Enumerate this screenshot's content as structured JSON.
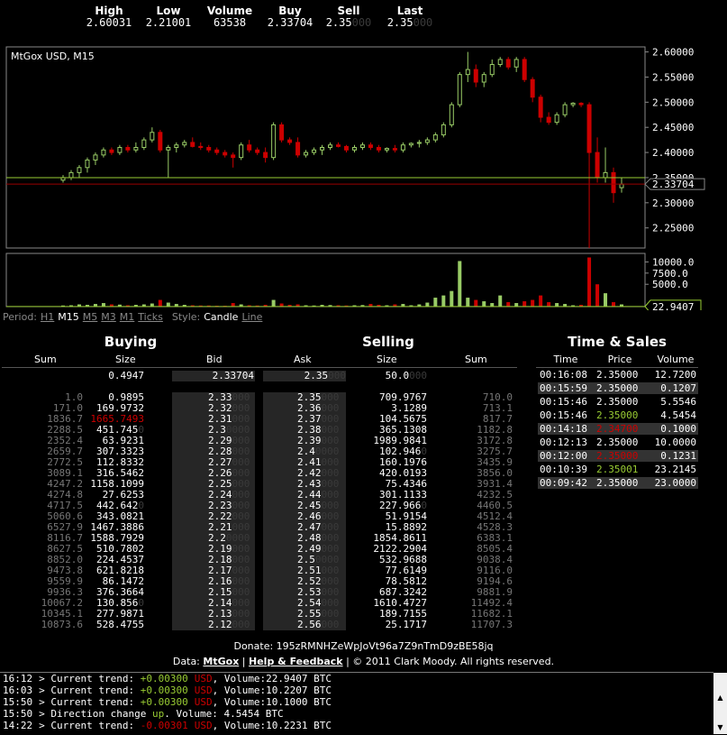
{
  "ticker": [
    {
      "label": "High",
      "value": "2.60031",
      "faint": ""
    },
    {
      "label": "Low",
      "value": "2.21001",
      "faint": ""
    },
    {
      "label": "Volume",
      "value": "63538",
      "faint": ""
    },
    {
      "label": "Buy",
      "value": "2.33704",
      "faint": ""
    },
    {
      "label": "Sell",
      "value": "2.35",
      "faint": "000"
    },
    {
      "label": "Last",
      "value": "2.35",
      "faint": "000"
    }
  ],
  "chart": {
    "title": "MtGox USD, M15",
    "price_ticks": [
      "2.60000",
      "2.55000",
      "2.50000",
      "2.45000",
      "2.40000",
      "2.35000",
      "2.30000",
      "2.25000"
    ],
    "current_price": "2.33704",
    "volume_ticks": [
      "10000.0",
      "7500.0",
      "5000.0"
    ],
    "volume_last": "22.9407",
    "colors": {
      "up": "#9c6",
      "down": "#c00",
      "bg": "#000",
      "border": "#888",
      "line_green": "#9c3",
      "line_red": "#900"
    }
  },
  "chart_data": {
    "type": "candlestick",
    "title": "MtGox USD, M15",
    "y_range": [
      2.21,
      2.61
    ],
    "volume_range": [
      0,
      11500
    ],
    "candles": [
      {
        "o": 2.345,
        "h": 2.355,
        "l": 2.34,
        "c": 2.35,
        "v": 250
      },
      {
        "o": 2.35,
        "h": 2.365,
        "l": 2.345,
        "c": 2.36,
        "v": 300
      },
      {
        "o": 2.36,
        "h": 2.375,
        "l": 2.35,
        "c": 2.37,
        "v": 500
      },
      {
        "o": 2.37,
        "h": 2.39,
        "l": 2.36,
        "c": 2.385,
        "v": 400
      },
      {
        "o": 2.385,
        "h": 2.4,
        "l": 2.375,
        "c": 2.395,
        "v": 600
      },
      {
        "o": 2.395,
        "h": 2.41,
        "l": 2.39,
        "c": 2.405,
        "v": 800
      },
      {
        "o": 2.405,
        "h": 2.41,
        "l": 2.395,
        "c": 2.4,
        "v": 500
      },
      {
        "o": 2.4,
        "h": 2.415,
        "l": 2.395,
        "c": 2.41,
        "v": 450
      },
      {
        "o": 2.41,
        "h": 2.415,
        "l": 2.4,
        "c": 2.405,
        "v": 300
      },
      {
        "o": 2.405,
        "h": 2.42,
        "l": 2.4,
        "c": 2.41,
        "v": 400
      },
      {
        "o": 2.41,
        "h": 2.43,
        "l": 2.405,
        "c": 2.425,
        "v": 500
      },
      {
        "o": 2.425,
        "h": 2.45,
        "l": 2.42,
        "c": 2.44,
        "v": 700
      },
      {
        "o": 2.44,
        "h": 2.445,
        "l": 2.4,
        "c": 2.405,
        "v": 1500
      },
      {
        "o": 2.405,
        "h": 2.415,
        "l": 2.35,
        "c": 2.41,
        "v": 900
      },
      {
        "o": 2.41,
        "h": 2.42,
        "l": 2.4,
        "c": 2.415,
        "v": 600
      },
      {
        "o": 2.415,
        "h": 2.425,
        "l": 2.41,
        "c": 2.42,
        "v": 400
      },
      {
        "o": 2.42,
        "h": 2.43,
        "l": 2.41,
        "c": 2.412,
        "v": 300
      },
      {
        "o": 2.412,
        "h": 2.42,
        "l": 2.405,
        "c": 2.41,
        "v": 250
      },
      {
        "o": 2.41,
        "h": 2.415,
        "l": 2.4,
        "c": 2.405,
        "v": 250
      },
      {
        "o": 2.405,
        "h": 2.41,
        "l": 2.395,
        "c": 2.4,
        "v": 200
      },
      {
        "o": 2.4,
        "h": 2.405,
        "l": 2.39,
        "c": 2.395,
        "v": 200
      },
      {
        "o": 2.395,
        "h": 2.4,
        "l": 2.37,
        "c": 2.39,
        "v": 800
      },
      {
        "o": 2.39,
        "h": 2.42,
        "l": 2.385,
        "c": 2.415,
        "v": 500
      },
      {
        "o": 2.415,
        "h": 2.425,
        "l": 2.4,
        "c": 2.405,
        "v": 300
      },
      {
        "o": 2.405,
        "h": 2.41,
        "l": 2.395,
        "c": 2.4,
        "v": 250
      },
      {
        "o": 2.4,
        "h": 2.41,
        "l": 2.38,
        "c": 2.39,
        "v": 400
      },
      {
        "o": 2.39,
        "h": 2.46,
        "l": 2.385,
        "c": 2.455,
        "v": 1500
      },
      {
        "o": 2.455,
        "h": 2.46,
        "l": 2.42,
        "c": 2.425,
        "v": 700
      },
      {
        "o": 2.425,
        "h": 2.43,
        "l": 2.415,
        "c": 2.42,
        "v": 400
      },
      {
        "o": 2.42,
        "h": 2.43,
        "l": 2.39,
        "c": 2.395,
        "v": 500
      },
      {
        "o": 2.395,
        "h": 2.405,
        "l": 2.39,
        "c": 2.4,
        "v": 300
      },
      {
        "o": 2.4,
        "h": 2.41,
        "l": 2.395,
        "c": 2.405,
        "v": 250
      },
      {
        "o": 2.405,
        "h": 2.415,
        "l": 2.395,
        "c": 2.41,
        "v": 400
      },
      {
        "o": 2.41,
        "h": 2.42,
        "l": 2.405,
        "c": 2.415,
        "v": 350
      },
      {
        "o": 2.415,
        "h": 2.42,
        "l": 2.41,
        "c": 2.412,
        "v": 300
      },
      {
        "o": 2.412,
        "h": 2.415,
        "l": 2.4,
        "c": 2.405,
        "v": 250
      },
      {
        "o": 2.405,
        "h": 2.415,
        "l": 2.4,
        "c": 2.41,
        "v": 300
      },
      {
        "o": 2.41,
        "h": 2.42,
        "l": 2.405,
        "c": 2.415,
        "v": 350
      },
      {
        "o": 2.415,
        "h": 2.42,
        "l": 2.405,
        "c": 2.41,
        "v": 600
      },
      {
        "o": 2.41,
        "h": 2.415,
        "l": 2.4,
        "c": 2.405,
        "v": 400
      },
      {
        "o": 2.405,
        "h": 2.41,
        "l": 2.4,
        "c": 2.408,
        "v": 300
      },
      {
        "o": 2.408,
        "h": 2.415,
        "l": 2.4,
        "c": 2.405,
        "v": 500
      },
      {
        "o": 2.405,
        "h": 2.42,
        "l": 2.4,
        "c": 2.415,
        "v": 600
      },
      {
        "o": 2.415,
        "h": 2.42,
        "l": 2.41,
        "c": 2.418,
        "v": 300
      },
      {
        "o": 2.418,
        "h": 2.425,
        "l": 2.41,
        "c": 2.42,
        "v": 500
      },
      {
        "o": 2.42,
        "h": 2.43,
        "l": 2.415,
        "c": 2.425,
        "v": 900
      },
      {
        "o": 2.425,
        "h": 2.44,
        "l": 2.42,
        "c": 2.435,
        "v": 2000
      },
      {
        "o": 2.435,
        "h": 2.46,
        "l": 2.43,
        "c": 2.455,
        "v": 2500
      },
      {
        "o": 2.455,
        "h": 2.5,
        "l": 2.45,
        "c": 2.495,
        "v": 3500
      },
      {
        "o": 2.495,
        "h": 2.56,
        "l": 2.49,
        "c": 2.555,
        "v": 10200
      },
      {
        "o": 2.555,
        "h": 2.6,
        "l": 2.54,
        "c": 2.565,
        "v": 2000
      },
      {
        "o": 2.565,
        "h": 2.575,
        "l": 2.53,
        "c": 2.54,
        "v": 1500
      },
      {
        "o": 2.54,
        "h": 2.56,
        "l": 2.53,
        "c": 2.555,
        "v": 1200
      },
      {
        "o": 2.555,
        "h": 2.585,
        "l": 2.55,
        "c": 2.575,
        "v": 800
      },
      {
        "o": 2.575,
        "h": 2.59,
        "l": 2.57,
        "c": 2.585,
        "v": 2500
      },
      {
        "o": 2.585,
        "h": 2.59,
        "l": 2.565,
        "c": 2.57,
        "v": 1000
      },
      {
        "o": 2.57,
        "h": 2.59,
        "l": 2.56,
        "c": 2.585,
        "v": 800
      },
      {
        "o": 2.585,
        "h": 2.59,
        "l": 2.54,
        "c": 2.545,
        "v": 1200
      },
      {
        "o": 2.545,
        "h": 2.55,
        "l": 2.5,
        "c": 2.51,
        "v": 1500
      },
      {
        "o": 2.51,
        "h": 2.515,
        "l": 2.46,
        "c": 2.47,
        "v": 2500
      },
      {
        "o": 2.47,
        "h": 2.48,
        "l": 2.455,
        "c": 2.46,
        "v": 1000
      },
      {
        "o": 2.46,
        "h": 2.48,
        "l": 2.455,
        "c": 2.475,
        "v": 800
      },
      {
        "o": 2.475,
        "h": 2.5,
        "l": 2.47,
        "c": 2.495,
        "v": 600
      },
      {
        "o": 2.495,
        "h": 2.5,
        "l": 2.49,
        "c": 2.498,
        "v": 300
      },
      {
        "o": 2.498,
        "h": 2.5,
        "l": 2.49,
        "c": 2.495,
        "v": 400
      },
      {
        "o": 2.495,
        "h": 2.5,
        "l": 2.21,
        "c": 2.4,
        "v": 11000
      },
      {
        "o": 2.4,
        "h": 2.43,
        "l": 2.34,
        "c": 2.35,
        "v": 5000
      },
      {
        "o": 2.35,
        "h": 2.41,
        "l": 2.34,
        "c": 2.36,
        "v": 3000
      },
      {
        "o": 2.36,
        "h": 2.37,
        "l": 2.3,
        "c": 2.32,
        "v": 1000
      },
      {
        "o": 2.33,
        "h": 2.35,
        "l": 2.32,
        "c": 2.337,
        "v": 500
      }
    ]
  },
  "period": {
    "label": "Period:",
    "options": [
      "H1",
      "M15",
      "M5",
      "M3",
      "M1",
      "Ticks"
    ],
    "selected": "M15",
    "style_label": "Style:",
    "styles": [
      "Candle",
      "Line"
    ],
    "style_selected": "Candle"
  },
  "buying": {
    "title": "Buying",
    "headers": [
      "Sum",
      "Size",
      "Bid"
    ],
    "best": {
      "size": "0.4947",
      "bid": "2.33704"
    },
    "rows": [
      {
        "sum": "1.0",
        "size": "0.9895",
        "bid": "2.33",
        "bidfaint": "000",
        "hl": false
      },
      {
        "sum": "171.0",
        "size": "169.9732",
        "bid": "2.32",
        "bidfaint": "000",
        "hl": false
      },
      {
        "sum": "1836.7",
        "size": "1665.7493",
        "bid": "2.31",
        "bidfaint": "000",
        "hl": true
      },
      {
        "sum": "2288.5",
        "size": "451.745",
        "sizefaint": "0",
        "bid": "2.3",
        "bidfaint": "0000",
        "hl": false
      },
      {
        "sum": "2352.4",
        "size": "63.9231",
        "bid": "2.29",
        "bidfaint": "000",
        "hl": false
      },
      {
        "sum": "2659.7",
        "size": "307.3323",
        "bid": "2.28",
        "bidfaint": "000",
        "hl": false
      },
      {
        "sum": "2772.5",
        "size": "112.8332",
        "bid": "2.27",
        "bidfaint": "000",
        "hl": false
      },
      {
        "sum": "3089.1",
        "size": "316.5462",
        "bid": "2.26",
        "bidfaint": "000",
        "hl": false
      },
      {
        "sum": "4247.2",
        "size": "1158.1099",
        "bid": "2.25",
        "bidfaint": "000",
        "hl": false
      },
      {
        "sum": "4274.8",
        "size": "27.6253",
        "bid": "2.24",
        "bidfaint": "000",
        "hl": false
      },
      {
        "sum": "4717.5",
        "size": "442.642",
        "sizefaint": "0",
        "bid": "2.23",
        "bidfaint": "000",
        "hl": false
      },
      {
        "sum": "5060.6",
        "size": "343.0821",
        "bid": "2.22",
        "bidfaint": "000",
        "hl": false
      },
      {
        "sum": "6527.9",
        "size": "1467.3886",
        "bid": "2.21",
        "bidfaint": "000",
        "hl": false
      },
      {
        "sum": "8116.7",
        "size": "1588.7929",
        "bid": "2.2",
        "bidfaint": "0000",
        "hl": false
      },
      {
        "sum": "8627.5",
        "size": "510.7802",
        "bid": "2.19",
        "bidfaint": "000",
        "hl": false
      },
      {
        "sum": "8852.0",
        "size": "224.4537",
        "bid": "2.18",
        "bidfaint": "000",
        "hl": false
      },
      {
        "sum": "9473.8",
        "size": "621.8218",
        "bid": "2.17",
        "bidfaint": "000",
        "hl": false
      },
      {
        "sum": "9559.9",
        "size": "86.1472",
        "bid": "2.16",
        "bidfaint": "000",
        "hl": false
      },
      {
        "sum": "9936.3",
        "size": "376.3664",
        "bid": "2.15",
        "bidfaint": "000",
        "hl": false
      },
      {
        "sum": "10067.2",
        "size": "130.856",
        "sizefaint": "0",
        "bid": "2.14",
        "bidfaint": "000",
        "hl": false
      },
      {
        "sum": "10345.1",
        "size": "277.9871",
        "bid": "2.13",
        "bidfaint": "000",
        "hl": false
      },
      {
        "sum": "10873.6",
        "size": "528.4755",
        "bid": "2.12",
        "bidfaint": "000",
        "hl": false
      }
    ]
  },
  "selling": {
    "title": "Selling",
    "headers": [
      "Ask",
      "Size",
      "Sum"
    ],
    "best": {
      "ask": "2.35",
      "askfaint": "000",
      "size": "50.0",
      "sizefaint": "000"
    },
    "rows": [
      {
        "ask": "2.35",
        "askfaint": "000",
        "size": "709.9767",
        "sum": "710.0"
      },
      {
        "ask": "2.36",
        "askfaint": "000",
        "size": "3.1289",
        "sum": "713.1"
      },
      {
        "ask": "2.37",
        "askfaint": "000",
        "size": "104.5675",
        "sum": "817.7"
      },
      {
        "ask": "2.38",
        "askfaint": "000",
        "size": "365.1308",
        "sum": "1182.8"
      },
      {
        "ask": "2.39",
        "askfaint": "000",
        "size": "1989.9841",
        "sum": "3172.8"
      },
      {
        "ask": "2.4",
        "askfaint": "0000",
        "size": "102.946",
        "sizefaint": "0",
        "sum": "3275.7"
      },
      {
        "ask": "2.41",
        "askfaint": "000",
        "size": "160.1976",
        "sum": "3435.9"
      },
      {
        "ask": "2.42",
        "askfaint": "000",
        "size": "420.0193",
        "sum": "3856.0"
      },
      {
        "ask": "2.43",
        "askfaint": "000",
        "size": "75.4346",
        "sum": "3931.4"
      },
      {
        "ask": "2.44",
        "askfaint": "000",
        "size": "301.1133",
        "sum": "4232.5"
      },
      {
        "ask": "2.45",
        "askfaint": "000",
        "size": "227.966",
        "sizefaint": "0",
        "sum": "4460.5"
      },
      {
        "ask": "2.46",
        "askfaint": "000",
        "size": "51.9154",
        "sum": "4512.4"
      },
      {
        "ask": "2.47",
        "askfaint": "000",
        "size": "15.8892",
        "sum": "4528.3"
      },
      {
        "ask": "2.48",
        "askfaint": "000",
        "size": "1854.8611",
        "sum": "6383.1"
      },
      {
        "ask": "2.49",
        "askfaint": "000",
        "size": "2122.2904",
        "sum": "8505.4"
      },
      {
        "ask": "2.5",
        "askfaint": "0000",
        "size": "532.9688",
        "sum": "9038.4"
      },
      {
        "ask": "2.51",
        "askfaint": "000",
        "size": "77.6149",
        "sum": "9116.0"
      },
      {
        "ask": "2.52",
        "askfaint": "000",
        "size": "78.5812",
        "sum": "9194.6"
      },
      {
        "ask": "2.53",
        "askfaint": "000",
        "size": "687.3242",
        "sum": "9881.9"
      },
      {
        "ask": "2.54",
        "askfaint": "000",
        "size": "1610.4727",
        "sum": "11492.4"
      },
      {
        "ask": "2.55",
        "askfaint": "000",
        "size": "189.7155",
        "sum": "11682.1"
      },
      {
        "ask": "2.56",
        "askfaint": "000",
        "size": "25.1717",
        "sum": "11707.3"
      }
    ]
  },
  "time_sales": {
    "title": "Time & Sales",
    "headers": [
      "Time",
      "Price",
      "Volume"
    ],
    "rows": [
      {
        "time": "00:16:08",
        "price": "2.35000",
        "color": "white",
        "volume": "12.7200",
        "shade": false
      },
      {
        "time": "00:15:59",
        "price": "2.35000",
        "color": "white",
        "volume": "0.1207",
        "shade": true
      },
      {
        "time": "00:15:46",
        "price": "2.35000",
        "color": "white",
        "volume": "5.5546",
        "shade": false
      },
      {
        "time": "00:15:46",
        "price": "2.35000",
        "color": "green",
        "volume": "4.5454",
        "shade": false
      },
      {
        "time": "00:14:18",
        "price": "2.34700",
        "color": "red",
        "volume": "0.1000",
        "shade": true
      },
      {
        "time": "00:12:13",
        "price": "2.35000",
        "color": "white",
        "volume": "10.0000",
        "shade": false
      },
      {
        "time": "00:12:00",
        "price": "2.35000",
        "color": "red",
        "volume": "0.1231",
        "shade": true
      },
      {
        "time": "00:10:39",
        "price": "2.35001",
        "color": "green",
        "volume": "23.2145",
        "shade": false
      },
      {
        "time": "00:09:42",
        "price": "2.35000",
        "color": "white",
        "volume": "23.0000",
        "shade": true
      }
    ]
  },
  "footer": {
    "donate_label": "Donate:",
    "donate_address": "195zRMNHZeWpJoVt96a7Z9nTmD9zBE58jq",
    "data_label": "Data:",
    "data_source": "MtGox",
    "help_link": "Help & Feedback",
    "copyright": "© 2011 Clark Moody. All rights reserved.",
    "sep": "|"
  },
  "console": [
    {
      "time": "16:12",
      "pre": "> Current trend: ",
      "val": "+0.00300",
      "valcolor": "green",
      "unit": "USD",
      "post": ", Volume:22.9407 BTC"
    },
    {
      "time": "16:03",
      "pre": "> Current trend: ",
      "val": "+0.00300",
      "valcolor": "green",
      "unit": "USD",
      "post": ", Volume:10.2207 BTC"
    },
    {
      "time": "15:50",
      "pre": "> Current trend: ",
      "val": "+0.00300",
      "valcolor": "green",
      "unit": "USD",
      "post": ", Volume:10.1000 BTC"
    },
    {
      "time": "15:50",
      "pre": "> Direction change ",
      "val": "up",
      "valcolor": "green",
      "unit": "",
      "post": ". Volume: 4.5454 BTC"
    },
    {
      "time": "14:22",
      "pre": "> Current trend: ",
      "val": "-0.00301",
      "valcolor": "red",
      "unit": "USD",
      "post": ", Volume:10.2231 BTC"
    }
  ]
}
